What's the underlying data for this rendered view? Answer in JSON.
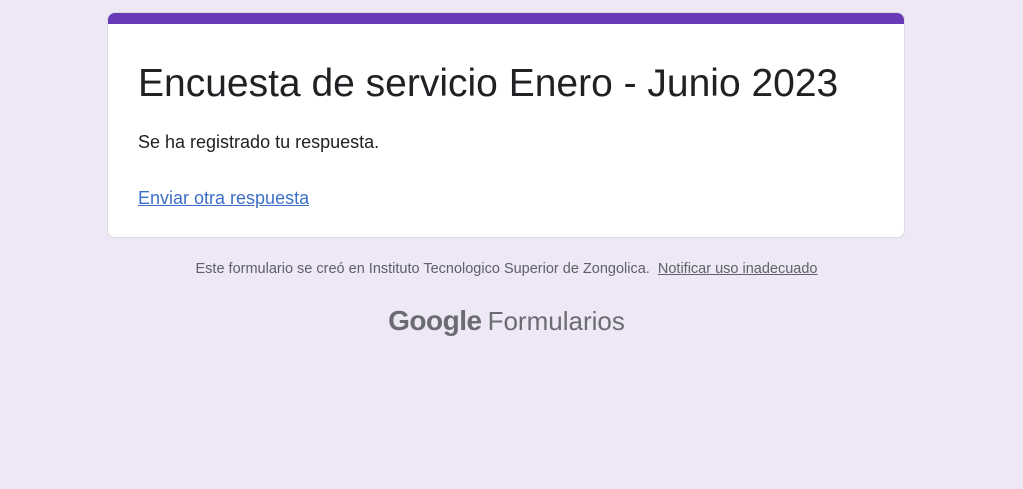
{
  "card": {
    "accent_color": "#673ab7",
    "title": "Encuesta de servicio Enero - Junio 2023",
    "confirmation_message": "Se ha registrado tu respuesta.",
    "another_response_link": "Enviar otra respuesta"
  },
  "footer": {
    "created_in_text": "Este formulario se creó en Instituto Tecnologico Superior de Zongolica.",
    "report_link": "Notificar uso inadecuado"
  },
  "brand": {
    "google": "Google",
    "product": "Formularios"
  }
}
